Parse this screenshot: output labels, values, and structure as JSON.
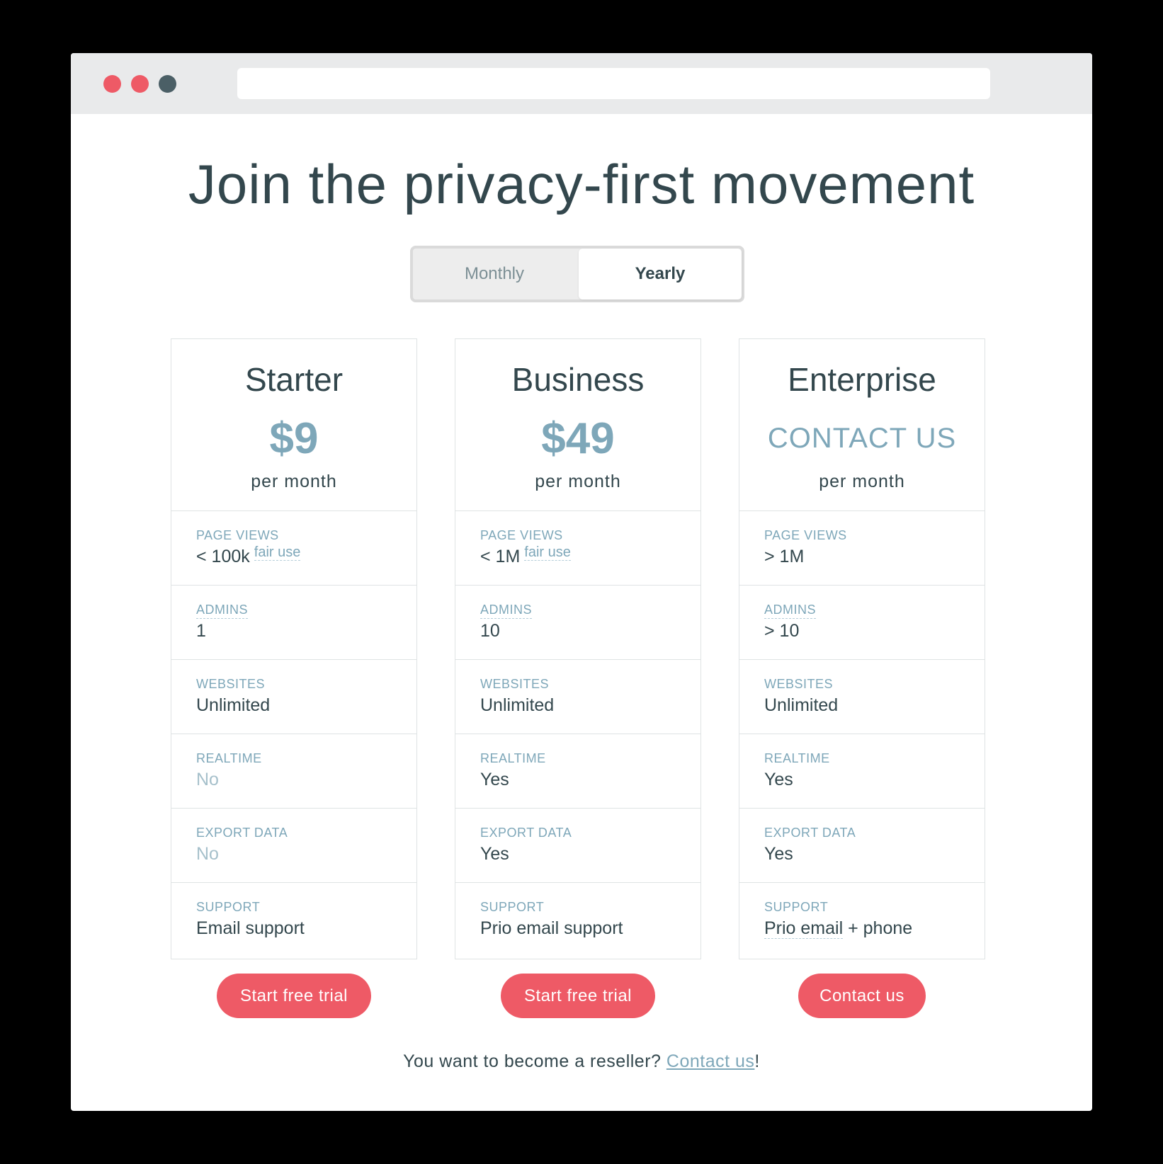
{
  "headline": "Join the privacy-first movement",
  "billing_toggle": {
    "monthly": "Monthly",
    "yearly": "Yearly",
    "selected": "Yearly"
  },
  "plans": [
    {
      "name": "Starter",
      "price": "$9",
      "period": "per month",
      "features": {
        "page_views": {
          "label": "PAGE VIEWS",
          "value": "< 100k",
          "note": "fair use"
        },
        "admins": {
          "label": "ADMINS",
          "value": "1"
        },
        "websites": {
          "label": "WEBSITES",
          "value": "Unlimited"
        },
        "realtime": {
          "label": "REALTIME",
          "value": "No"
        },
        "export_data": {
          "label": "EXPORT DATA",
          "value": "No"
        },
        "support": {
          "label": "SUPPORT",
          "value": "Email support"
        }
      },
      "cta": "Start free trial"
    },
    {
      "name": "Business",
      "price": "$49",
      "period": "per month",
      "features": {
        "page_views": {
          "label": "PAGE VIEWS",
          "value": "< 1M",
          "note": "fair use"
        },
        "admins": {
          "label": "ADMINS",
          "value": "10"
        },
        "websites": {
          "label": "WEBSITES",
          "value": "Unlimited"
        },
        "realtime": {
          "label": "REALTIME",
          "value": "Yes"
        },
        "export_data": {
          "label": "EXPORT DATA",
          "value": "Yes"
        },
        "support": {
          "label": "SUPPORT",
          "value": "Prio email support"
        }
      },
      "cta": "Start free trial"
    },
    {
      "name": "Enterprise",
      "price": "CONTACT US",
      "period": "per month",
      "features": {
        "page_views": {
          "label": "PAGE VIEWS",
          "value": "> 1M"
        },
        "admins": {
          "label": "ADMINS",
          "value": "> 10"
        },
        "websites": {
          "label": "WEBSITES",
          "value": "Unlimited"
        },
        "realtime": {
          "label": "REALTIME",
          "value": "Yes"
        },
        "export_data": {
          "label": "EXPORT DATA",
          "value": "Yes"
        },
        "support": {
          "label": "SUPPORT",
          "value_a": "Prio email",
          "value_b": " + phone"
        }
      },
      "cta": "Contact us"
    }
  ],
  "footer": {
    "text": "You want to become a reseller? ",
    "link": "Contact us",
    "suffix": "!"
  },
  "colors": {
    "accent": "#ee5a66",
    "price": "#7ea7b9",
    "text": "#33474d",
    "titlebar": "#e9eaeb"
  }
}
